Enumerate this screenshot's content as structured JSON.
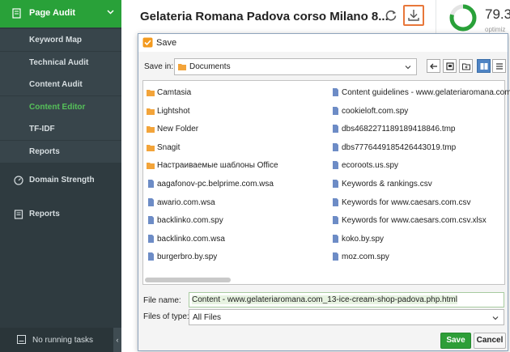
{
  "colors": {
    "sidebar_bg": "#2f3b40",
    "brand_green": "#29a139",
    "active_green": "#56c15a",
    "download_accent": "#e8773a",
    "selected_view": "#4f84c4"
  },
  "sidebar": {
    "header": {
      "label": "Page Audit",
      "icon": "page-audit-icon"
    },
    "sub_items": [
      {
        "label": "Keyword Map",
        "active": false
      },
      {
        "label": "Technical Audit",
        "active": false
      },
      {
        "label": "Content Audit",
        "active": false
      },
      {
        "label": "Content Editor",
        "active": true
      },
      {
        "label": "TF-IDF",
        "active": false
      },
      {
        "label": "Reports",
        "active": false
      }
    ],
    "sections": [
      {
        "label": "Domain Strength",
        "icon": "gauge-icon"
      },
      {
        "label": "Reports",
        "icon": "report-icon"
      }
    ],
    "footer": {
      "label": "No running tasks",
      "icon": "tasks-icon"
    }
  },
  "header": {
    "title": "Gelateria Romana Padova corso Milano 8...",
    "score": "79.3",
    "score_label": "optimiz",
    "score_fraction": 0.793
  },
  "dialog": {
    "title": "Save",
    "save_in_label": "Save in:",
    "save_in_value": "Documents",
    "file_name_label": "File name:",
    "file_name_value": "Content - www.gelateriaromana.com_13-ice-cream-shop-padova.php.html",
    "files_of_type_label": "Files of type:",
    "files_of_type_value": "All Files",
    "save_button": "Save",
    "cancel_button": "Cancel",
    "files_col1": [
      {
        "name": "Camtasia",
        "kind": "folder"
      },
      {
        "name": "Lightshot",
        "kind": "folder"
      },
      {
        "name": "New Folder",
        "kind": "folder"
      },
      {
        "name": "Snagit",
        "kind": "folder"
      },
      {
        "name": "Настраиваемые шаблоны Office",
        "kind": "folder"
      },
      {
        "name": "aagafonov-pc.belprime.com.wsa",
        "kind": "file"
      },
      {
        "name": "awario.com.wsa",
        "kind": "file"
      },
      {
        "name": "backlinko.com.spy",
        "kind": "file"
      },
      {
        "name": "backlinko.com.wsa",
        "kind": "file"
      },
      {
        "name": "burgerbro.by.spy",
        "kind": "file"
      }
    ],
    "files_col2": [
      {
        "name": "Content guidelines - www.gelateriaromana.com.pdf",
        "kind": "file"
      },
      {
        "name": "cookieloft.com.spy",
        "kind": "file"
      },
      {
        "name": "dbs4682271189189418846.tmp",
        "kind": "file"
      },
      {
        "name": "dbs7776449185426443019.tmp",
        "kind": "file"
      },
      {
        "name": "ecoroots.us.spy",
        "kind": "file"
      },
      {
        "name": "Keywords & rankings.csv",
        "kind": "file"
      },
      {
        "name": "Keywords for www.caesars.com.csv",
        "kind": "file"
      },
      {
        "name": "Keywords for www.caesars.com.csv.xlsx",
        "kind": "file"
      },
      {
        "name": "koko.by.spy",
        "kind": "file"
      },
      {
        "name": "moz.com.spy",
        "kind": "file"
      }
    ]
  }
}
